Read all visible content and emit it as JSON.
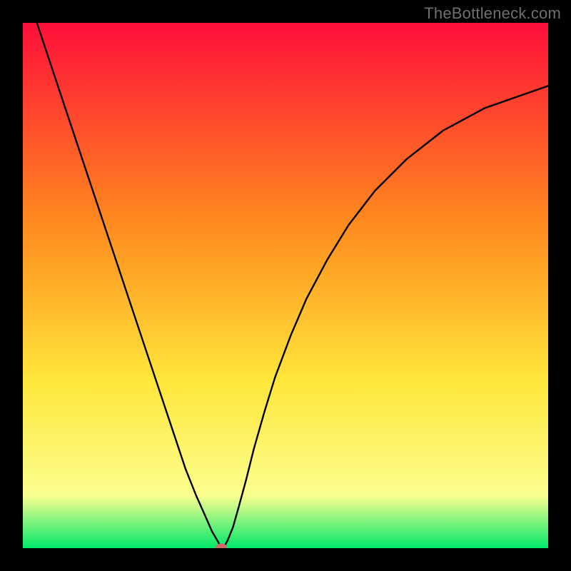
{
  "watermark": "TheBottleneck.com",
  "chart_data": {
    "type": "line",
    "title": "",
    "xlabel": "",
    "ylabel": "",
    "xlim": [
      0,
      100
    ],
    "ylim": [
      0,
      100
    ],
    "gradient_colors": {
      "top": "#ff0f3a",
      "mid1": "#ff8a1e",
      "mid2": "#ffe63a",
      "mid3": "#fbff8f",
      "bottom": "#00e86a"
    },
    "series": [
      {
        "name": "bottleneck-curve",
        "x": [
          0,
          2,
          5,
          8,
          11,
          14,
          17,
          20,
          23,
          26,
          29,
          31,
          33,
          35,
          36,
          37,
          37.5,
          38,
          38.5,
          39,
          40,
          41,
          42.5,
          44,
          46,
          48,
          51,
          54,
          58,
          62,
          67,
          73,
          80,
          88,
          100
        ],
        "y": [
          110,
          102,
          93,
          84,
          75,
          66,
          57,
          48,
          39,
          30,
          21,
          15,
          10,
          5.5,
          3.2,
          1.5,
          0.6,
          0.1,
          0.6,
          1.5,
          4,
          7.5,
          13,
          19,
          26,
          32.5,
          40.5,
          47.5,
          55,
          61.5,
          68,
          74,
          79.5,
          83.8,
          88
        ]
      }
    ],
    "marker": {
      "name": "optimum-point",
      "x": 37.8,
      "y": 0.2,
      "color": "#cf6a6f",
      "rx": 8,
      "ry": 5
    }
  }
}
